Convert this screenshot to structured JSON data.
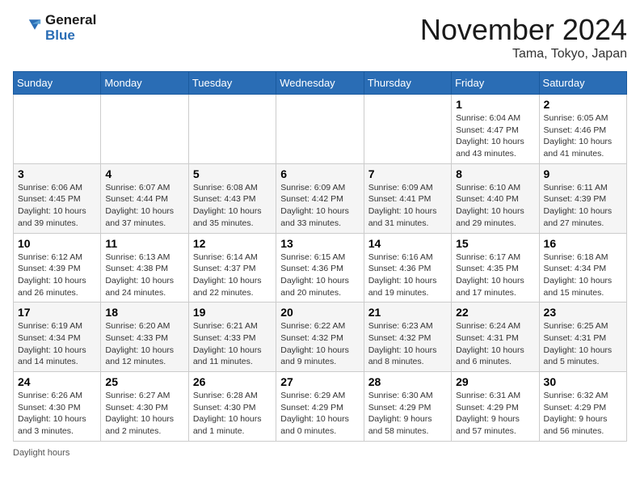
{
  "header": {
    "logo_line1": "General",
    "logo_line2": "Blue",
    "month_title": "November 2024",
    "location": "Tama, Tokyo, Japan"
  },
  "weekdays": [
    "Sunday",
    "Monday",
    "Tuesday",
    "Wednesday",
    "Thursday",
    "Friday",
    "Saturday"
  ],
  "legend": {
    "daylight_label": "Daylight hours"
  },
  "weeks": [
    [
      {
        "day": "",
        "sunrise": "",
        "sunset": "",
        "daylight": ""
      },
      {
        "day": "",
        "sunrise": "",
        "sunset": "",
        "daylight": ""
      },
      {
        "day": "",
        "sunrise": "",
        "sunset": "",
        "daylight": ""
      },
      {
        "day": "",
        "sunrise": "",
        "sunset": "",
        "daylight": ""
      },
      {
        "day": "",
        "sunrise": "",
        "sunset": "",
        "daylight": ""
      },
      {
        "day": "1",
        "sunrise": "Sunrise: 6:04 AM",
        "sunset": "Sunset: 4:47 PM",
        "daylight": "Daylight: 10 hours and 43 minutes."
      },
      {
        "day": "2",
        "sunrise": "Sunrise: 6:05 AM",
        "sunset": "Sunset: 4:46 PM",
        "daylight": "Daylight: 10 hours and 41 minutes."
      }
    ],
    [
      {
        "day": "3",
        "sunrise": "Sunrise: 6:06 AM",
        "sunset": "Sunset: 4:45 PM",
        "daylight": "Daylight: 10 hours and 39 minutes."
      },
      {
        "day": "4",
        "sunrise": "Sunrise: 6:07 AM",
        "sunset": "Sunset: 4:44 PM",
        "daylight": "Daylight: 10 hours and 37 minutes."
      },
      {
        "day": "5",
        "sunrise": "Sunrise: 6:08 AM",
        "sunset": "Sunset: 4:43 PM",
        "daylight": "Daylight: 10 hours and 35 minutes."
      },
      {
        "day": "6",
        "sunrise": "Sunrise: 6:09 AM",
        "sunset": "Sunset: 4:42 PM",
        "daylight": "Daylight: 10 hours and 33 minutes."
      },
      {
        "day": "7",
        "sunrise": "Sunrise: 6:09 AM",
        "sunset": "Sunset: 4:41 PM",
        "daylight": "Daylight: 10 hours and 31 minutes."
      },
      {
        "day": "8",
        "sunrise": "Sunrise: 6:10 AM",
        "sunset": "Sunset: 4:40 PM",
        "daylight": "Daylight: 10 hours and 29 minutes."
      },
      {
        "day": "9",
        "sunrise": "Sunrise: 6:11 AM",
        "sunset": "Sunset: 4:39 PM",
        "daylight": "Daylight: 10 hours and 27 minutes."
      }
    ],
    [
      {
        "day": "10",
        "sunrise": "Sunrise: 6:12 AM",
        "sunset": "Sunset: 4:39 PM",
        "daylight": "Daylight: 10 hours and 26 minutes."
      },
      {
        "day": "11",
        "sunrise": "Sunrise: 6:13 AM",
        "sunset": "Sunset: 4:38 PM",
        "daylight": "Daylight: 10 hours and 24 minutes."
      },
      {
        "day": "12",
        "sunrise": "Sunrise: 6:14 AM",
        "sunset": "Sunset: 4:37 PM",
        "daylight": "Daylight: 10 hours and 22 minutes."
      },
      {
        "day": "13",
        "sunrise": "Sunrise: 6:15 AM",
        "sunset": "Sunset: 4:36 PM",
        "daylight": "Daylight: 10 hours and 20 minutes."
      },
      {
        "day": "14",
        "sunrise": "Sunrise: 6:16 AM",
        "sunset": "Sunset: 4:36 PM",
        "daylight": "Daylight: 10 hours and 19 minutes."
      },
      {
        "day": "15",
        "sunrise": "Sunrise: 6:17 AM",
        "sunset": "Sunset: 4:35 PM",
        "daylight": "Daylight: 10 hours and 17 minutes."
      },
      {
        "day": "16",
        "sunrise": "Sunrise: 6:18 AM",
        "sunset": "Sunset: 4:34 PM",
        "daylight": "Daylight: 10 hours and 15 minutes."
      }
    ],
    [
      {
        "day": "17",
        "sunrise": "Sunrise: 6:19 AM",
        "sunset": "Sunset: 4:34 PM",
        "daylight": "Daylight: 10 hours and 14 minutes."
      },
      {
        "day": "18",
        "sunrise": "Sunrise: 6:20 AM",
        "sunset": "Sunset: 4:33 PM",
        "daylight": "Daylight: 10 hours and 12 minutes."
      },
      {
        "day": "19",
        "sunrise": "Sunrise: 6:21 AM",
        "sunset": "Sunset: 4:33 PM",
        "daylight": "Daylight: 10 hours and 11 minutes."
      },
      {
        "day": "20",
        "sunrise": "Sunrise: 6:22 AM",
        "sunset": "Sunset: 4:32 PM",
        "daylight": "Daylight: 10 hours and 9 minutes."
      },
      {
        "day": "21",
        "sunrise": "Sunrise: 6:23 AM",
        "sunset": "Sunset: 4:32 PM",
        "daylight": "Daylight: 10 hours and 8 minutes."
      },
      {
        "day": "22",
        "sunrise": "Sunrise: 6:24 AM",
        "sunset": "Sunset: 4:31 PM",
        "daylight": "Daylight: 10 hours and 6 minutes."
      },
      {
        "day": "23",
        "sunrise": "Sunrise: 6:25 AM",
        "sunset": "Sunset: 4:31 PM",
        "daylight": "Daylight: 10 hours and 5 minutes."
      }
    ],
    [
      {
        "day": "24",
        "sunrise": "Sunrise: 6:26 AM",
        "sunset": "Sunset: 4:30 PM",
        "daylight": "Daylight: 10 hours and 3 minutes."
      },
      {
        "day": "25",
        "sunrise": "Sunrise: 6:27 AM",
        "sunset": "Sunset: 4:30 PM",
        "daylight": "Daylight: 10 hours and 2 minutes."
      },
      {
        "day": "26",
        "sunrise": "Sunrise: 6:28 AM",
        "sunset": "Sunset: 4:30 PM",
        "daylight": "Daylight: 10 hours and 1 minute."
      },
      {
        "day": "27",
        "sunrise": "Sunrise: 6:29 AM",
        "sunset": "Sunset: 4:29 PM",
        "daylight": "Daylight: 10 hours and 0 minutes."
      },
      {
        "day": "28",
        "sunrise": "Sunrise: 6:30 AM",
        "sunset": "Sunset: 4:29 PM",
        "daylight": "Daylight: 9 hours and 58 minutes."
      },
      {
        "day": "29",
        "sunrise": "Sunrise: 6:31 AM",
        "sunset": "Sunset: 4:29 PM",
        "daylight": "Daylight: 9 hours and 57 minutes."
      },
      {
        "day": "30",
        "sunrise": "Sunrise: 6:32 AM",
        "sunset": "Sunset: 4:29 PM",
        "daylight": "Daylight: 9 hours and 56 minutes."
      }
    ]
  ]
}
